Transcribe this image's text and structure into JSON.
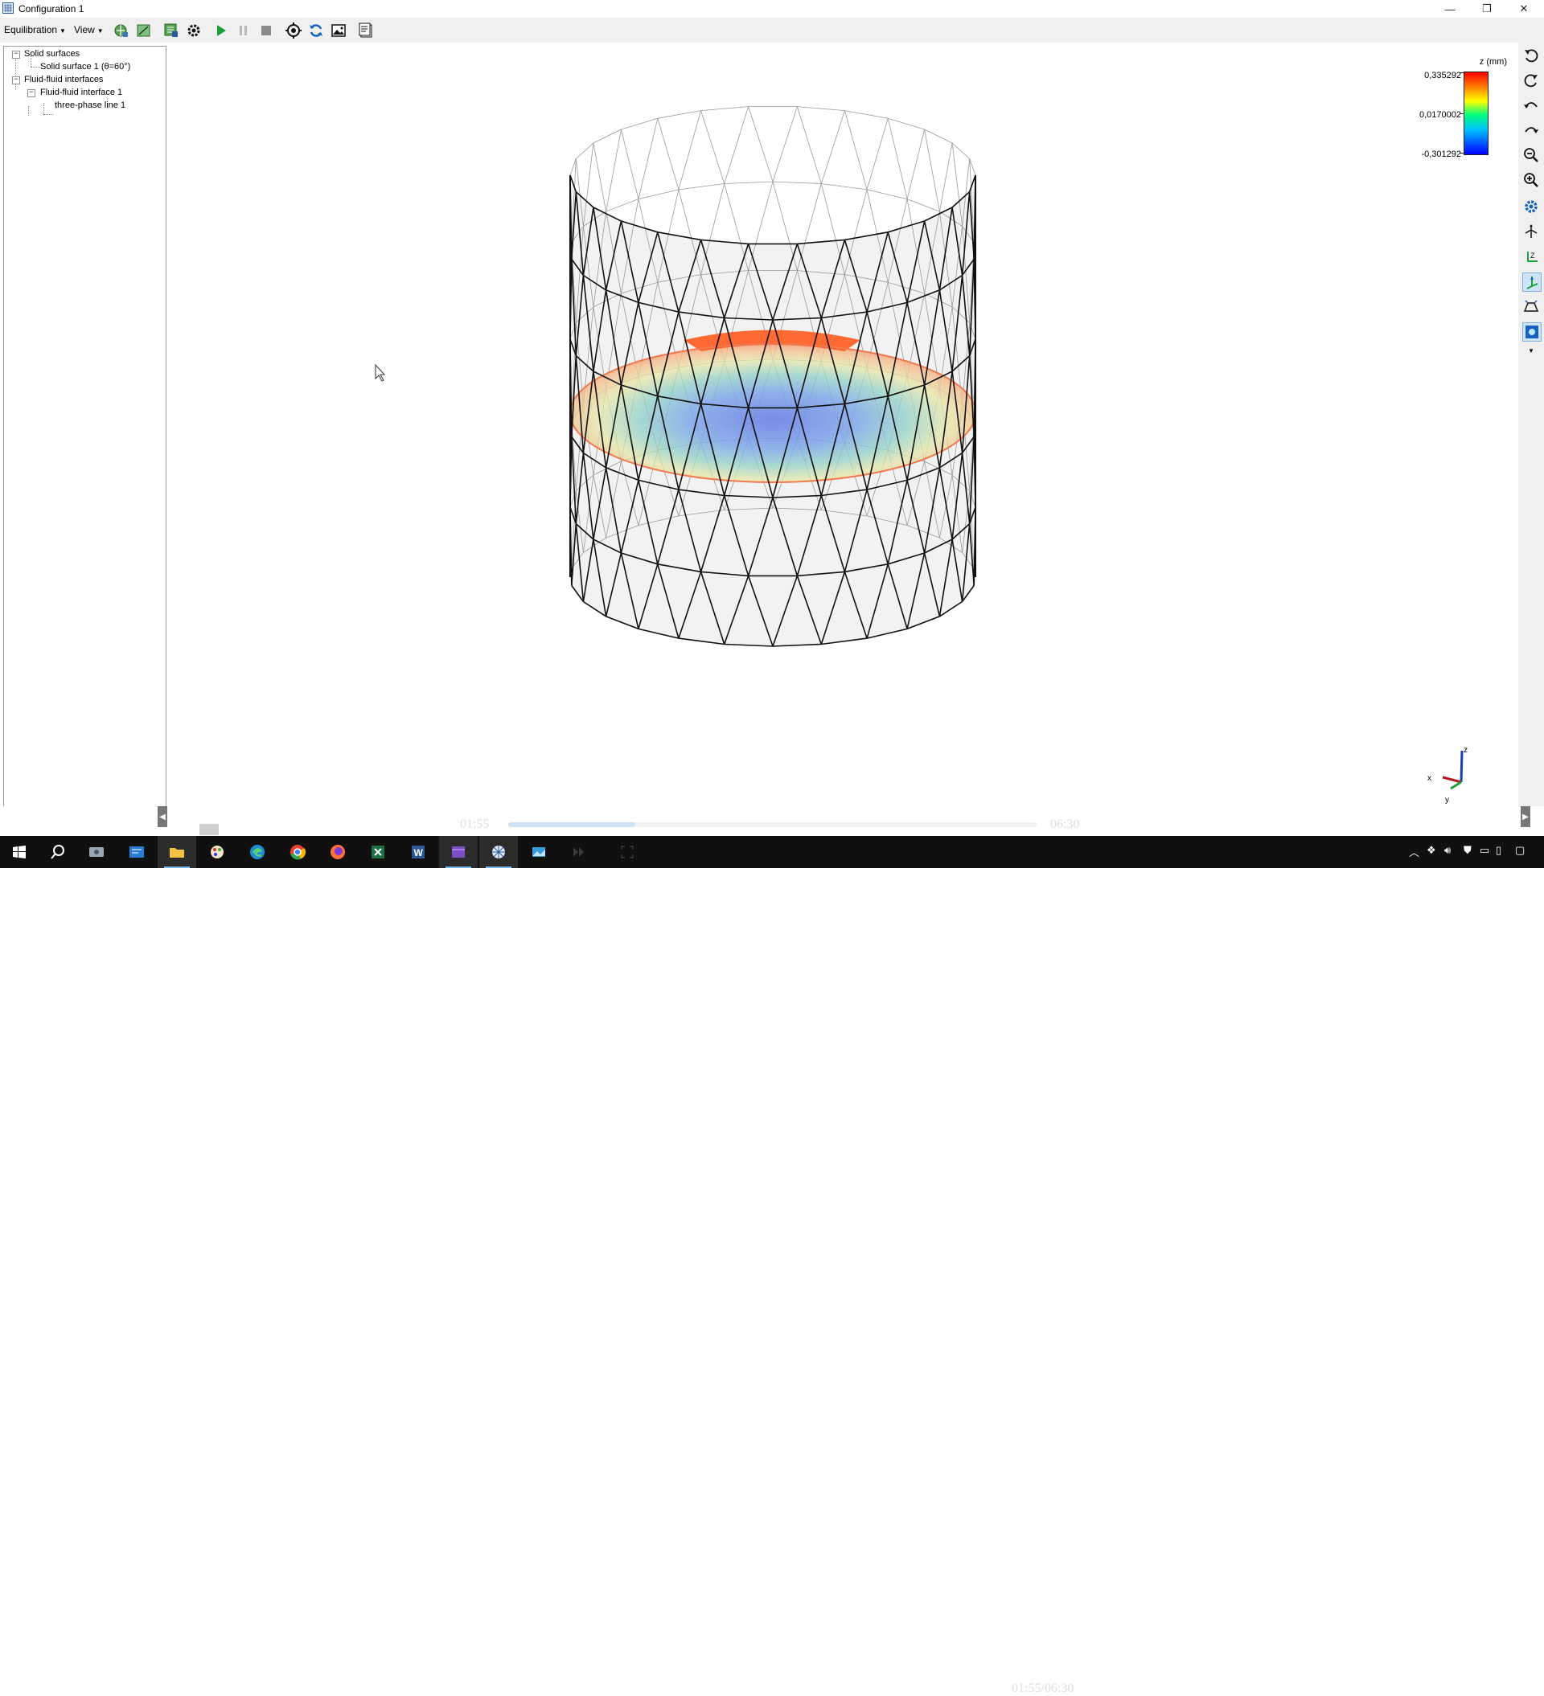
{
  "window": {
    "title": "Configuration 1",
    "minimize_glyph": "—",
    "restore_glyph": "❐",
    "close_glyph": "✕"
  },
  "toolbar": {
    "menus": [
      {
        "label": "Equilibration"
      },
      {
        "label": "View"
      }
    ],
    "icons": [
      "load-geometry-icon",
      "edit-surface-icon",
      "export-icon",
      "settings-gear-icon",
      "play-icon",
      "pause-icon",
      "stop-icon",
      "target-icon",
      "refresh-icon",
      "image-icon",
      "report-icon"
    ]
  },
  "tree": {
    "items": [
      {
        "label": "Solid surfaces",
        "expander": "−"
      },
      {
        "label": "Solid surface 1 (θ=60°)"
      },
      {
        "label": "Fluid-fluid interfaces",
        "expander": "−"
      },
      {
        "label": "Fluid-fluid interface 1",
        "expander": "−"
      },
      {
        "label": "three-phase line 1"
      }
    ]
  },
  "legend": {
    "title": "z (mm)",
    "max": "0,335292",
    "mid": "0,0170002",
    "min": "-0,301292",
    "colors": [
      "#ff0000",
      "#ff8000",
      "#ffff00",
      "#00ff80",
      "#00c0ff",
      "#0000ff"
    ]
  },
  "axes": {
    "x": "x",
    "y": "y",
    "z": "z"
  },
  "video": {
    "current": "01:55",
    "total": "06:30",
    "combined": "01:55/06:30",
    "progress": 0.24
  },
  "right_toolbar": {
    "icons": [
      "rotate-left-icon",
      "rotate-right-icon",
      "tilt-back-icon",
      "tilt-forward-icon",
      "zoom-out-icon",
      "zoom-in-icon",
      "view-settings-icon",
      "reset-view-icon",
      "axis-z-icon",
      "axis-view-icon",
      "perspective-icon",
      "snapshot-icon",
      "more-icon"
    ]
  },
  "taskbar": {
    "apps": [
      "start-icon",
      "search-icon",
      "task-view-icon",
      "store-icon",
      "file-explorer-icon",
      "paint-icon",
      "edge-icon",
      "chrome-icon",
      "firefox-icon",
      "excel-icon",
      "word-icon",
      "video-editor-icon",
      "surface-evolver-icon",
      "photos-icon"
    ],
    "tray": [
      "chevron-up-icon",
      "dropbox-icon",
      "volume-icon",
      "defender-icon",
      "network-icon",
      "display-icon",
      "notifications-icon"
    ]
  }
}
